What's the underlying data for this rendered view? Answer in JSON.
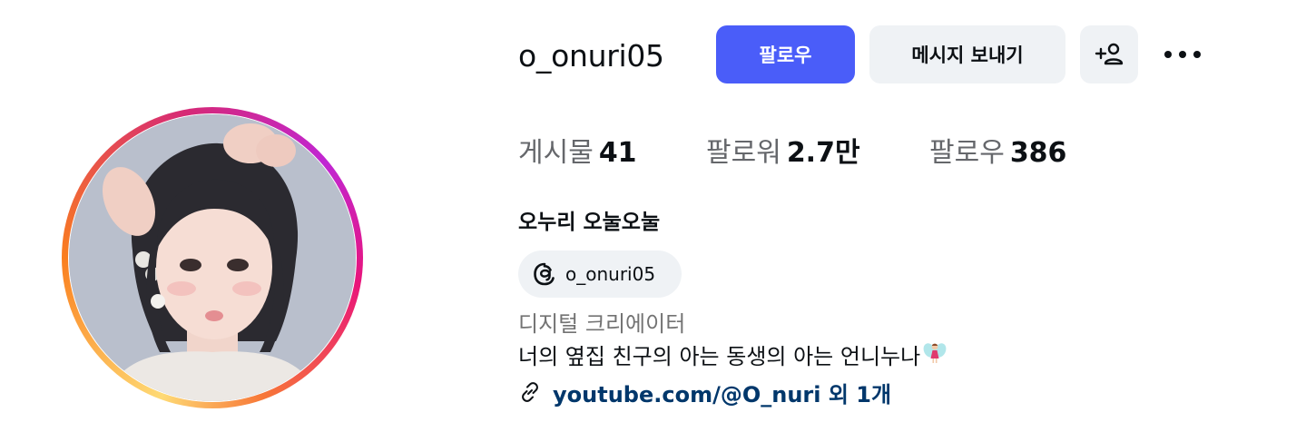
{
  "profile": {
    "username": "o_onuri05",
    "full_name": "오누리 오눌오눌",
    "category": "디지털 크리에이터",
    "bio": "너의 옆집 친구의 아는 동생의 아는 언니누나",
    "bio_emoji": "fairy-icon",
    "link_text": "youtube.com/@O_nuri 외 1개",
    "threads_handle": "o_onuri05",
    "avatar": "profile-photo"
  },
  "actions": {
    "follow_label": "팔로우",
    "message_label": "메시지 보내기",
    "add_friend_icon": "add-person-icon",
    "more_icon": "more-icon"
  },
  "stats": {
    "posts_label": "게시물",
    "posts_count": "41",
    "followers_label": "팔로워",
    "followers_count": "2.7만",
    "following_label": "팔로우",
    "following_count": "386"
  },
  "colors": {
    "follow_button": "#4a5df9",
    "secondary_button": "#eff2f5",
    "link": "#00376b",
    "muted_text": "#737373"
  }
}
